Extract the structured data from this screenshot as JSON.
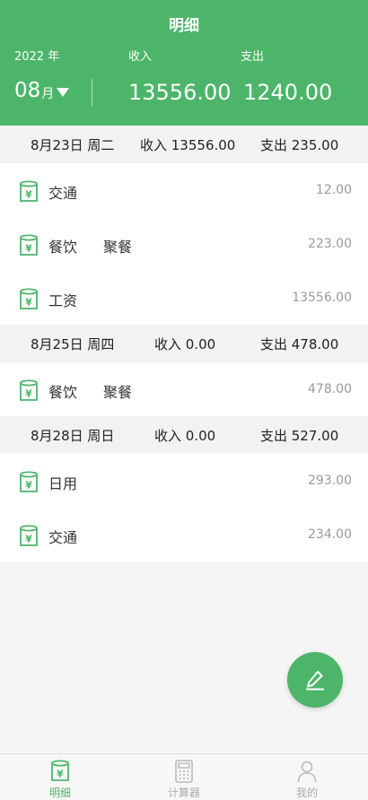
{
  "header": {
    "title": "明细",
    "year_label": "2022 年",
    "income_label": "收入",
    "expense_label": "支出",
    "month": "08",
    "month_unit": "月",
    "total_income": "13556.00",
    "total_expense": "1240.00"
  },
  "days": [
    {
      "date": "8月23日 周二",
      "income": "收入 13556.00",
      "expense": "支出 235.00",
      "items": [
        {
          "category": "交通",
          "note": "",
          "amount": "12.00"
        },
        {
          "category": "餐饮",
          "note": "聚餐",
          "amount": "223.00"
        },
        {
          "category": "工资",
          "note": "",
          "amount": "13556.00"
        }
      ]
    },
    {
      "date": "8月25日 周四",
      "income": "收入 0.00",
      "expense": "支出 478.00",
      "items": [
        {
          "category": "餐饮",
          "note": "聚餐",
          "amount": "478.00"
        }
      ]
    },
    {
      "date": "8月28日 周日",
      "income": "收入 0.00",
      "expense": "支出 527.00",
      "items": [
        {
          "category": "日用",
          "note": "",
          "amount": "293.00"
        },
        {
          "category": "交通",
          "note": "",
          "amount": "234.00"
        }
      ]
    }
  ],
  "fab": {
    "icon": "edit-icon"
  },
  "tabs": [
    {
      "label": "明细",
      "icon": "ledger-icon",
      "active": true
    },
    {
      "label": "计算器",
      "icon": "calculator-icon",
      "active": false
    },
    {
      "label": "我的",
      "icon": "person-icon",
      "active": false
    }
  ],
  "colors": {
    "accent": "#4cb56a",
    "amount": "#999999",
    "day_header_bg": "#f2f2f2"
  }
}
